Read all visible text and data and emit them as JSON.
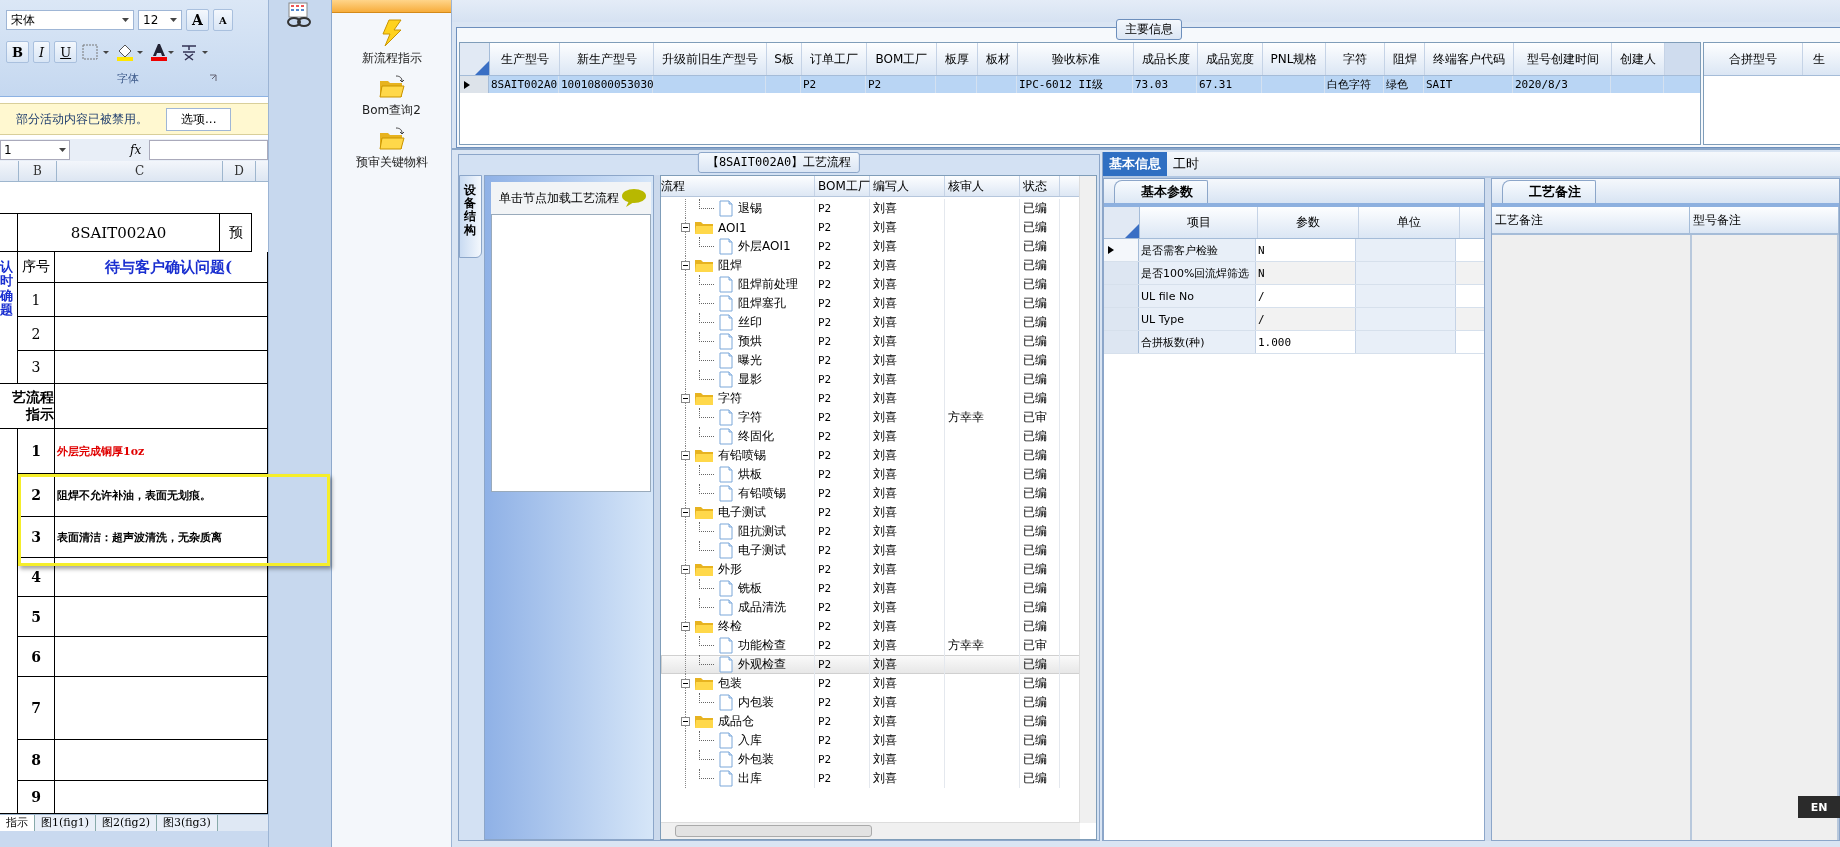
{
  "excel": {
    "font_name": "宋体",
    "font_size": "12",
    "grow_font": "A",
    "shrink_font": "A",
    "bold": "B",
    "italic": "I",
    "underline": "U",
    "group_label": "字体",
    "message": "部分活动内容已被禁用。",
    "options_button": "选项...",
    "name_box": "1",
    "fx": "fx",
    "columns": [
      "B",
      "C",
      "D"
    ],
    "title_cell": "8SAIT002A0",
    "title_right": "预",
    "seq_header": "序号",
    "question_header": "待与客户确认问题(",
    "side_label": "认时确题",
    "question_rows": [
      "1",
      "2",
      "3"
    ],
    "process_label": [
      "艺流程",
      "指示"
    ],
    "process_rows": [
      {
        "num": "1",
        "text": "外层完成铜厚1oz",
        "kind": "warning",
        "highlighted": false
      },
      {
        "num": "2",
        "text": "阻焊不允许补油，表面无划痕。",
        "kind": "normal",
        "highlighted": true
      },
      {
        "num": "3",
        "text": "表面清洁：超声波清洗，无杂质离",
        "kind": "normal",
        "highlighted": true
      },
      {
        "num": "4",
        "highlighted": false
      },
      {
        "num": "5",
        "highlighted": false
      },
      {
        "num": "6",
        "highlighted": false
      },
      {
        "num": "7",
        "highlighted": false
      },
      {
        "num": "8",
        "highlighted": false
      },
      {
        "num": "9",
        "highlighted": false
      }
    ],
    "sheet_tabs": [
      {
        "label": "指示",
        "selected": true
      },
      {
        "label": "图1(fig1)",
        "selected": false
      },
      {
        "label": "图2(fig2)",
        "selected": false
      },
      {
        "label": "图3(fig3)",
        "selected": false
      }
    ]
  },
  "nav": {
    "items": [
      {
        "label": "新流程指示",
        "kind": "lightning"
      },
      {
        "label": "Bom查询2",
        "kind": "folder"
      },
      {
        "label": "预审关键物料",
        "kind": "folder"
      }
    ]
  },
  "main_info": {
    "title": "主要信息",
    "columns": [
      "生产型号",
      "新生产型号",
      "升级前旧生产型号",
      "S板",
      "订单工厂",
      "BOM工厂",
      "板厚",
      "板材",
      "验收标准",
      "成品长度",
      "成品宽度",
      "PNL规格",
      "字符",
      "阻焊",
      "终端客户代码",
      "型号创建时间",
      "创建人"
    ],
    "rows": [
      {
        "selected": true,
        "cells": [
          "8SAIT002A0",
          "10010800053030",
          null,
          null,
          "P2",
          "P2",
          null,
          null,
          "IPC-6012 II级",
          "73.03",
          "67.31",
          null,
          "白色字符",
          "绿色",
          "SAIT",
          "2020/8/3",
          null
        ]
      }
    ],
    "merge_columns": [
      "合拼型号",
      "生"
    ]
  },
  "flow": {
    "title": "【8SAIT002A0】工艺流程",
    "side_tab": "设备结构",
    "hint": "单击节点加载工艺流程",
    "columns": [
      "流程",
      "BOM工厂",
      "编写人",
      "核审人",
      "状态"
    ],
    "continued": [
      {
        "label": "退锡",
        "bom": "P2",
        "writer": "刘喜",
        "status": "已编",
        "selected": false
      }
    ],
    "nodes": [
      {
        "label": "AOI1",
        "bom": "P2",
        "writer": "刘喜",
        "status": "已编",
        "expanded": true,
        "selected": false,
        "children": [
          {
            "label": "外层AOI1",
            "bom": "P2",
            "writer": "刘喜",
            "status": "已编",
            "selected": false
          }
        ]
      },
      {
        "label": "阻焊",
        "bom": "P2",
        "writer": "刘喜",
        "status": "已编",
        "expanded": true,
        "selected": false,
        "children": [
          {
            "label": "阻焊前处理",
            "bom": "P2",
            "writer": "刘喜",
            "status": "已编",
            "selected": false
          },
          {
            "label": "阻焊塞孔",
            "bom": "P2",
            "writer": "刘喜",
            "status": "已编",
            "selected": false
          },
          {
            "label": "丝印",
            "bom": "P2",
            "writer": "刘喜",
            "status": "已编",
            "selected": false
          },
          {
            "label": "预烘",
            "bom": "P2",
            "writer": "刘喜",
            "status": "已编",
            "selected": false
          },
          {
            "label": "曝光",
            "bom": "P2",
            "writer": "刘喜",
            "status": "已编",
            "selected": false
          },
          {
            "label": "显影",
            "bom": "P2",
            "writer": "刘喜",
            "status": "已编",
            "selected": false
          }
        ]
      },
      {
        "label": "字符",
        "bom": "P2",
        "writer": "刘喜",
        "status": "已编",
        "expanded": true,
        "selected": false,
        "children": [
          {
            "label": "字符",
            "bom": "P2",
            "writer": "刘喜",
            "reviewer": "方幸幸",
            "status": "已审",
            "selected": false
          },
          {
            "label": "终固化",
            "bom": "P2",
            "writer": "刘喜",
            "status": "已编",
            "selected": false
          }
        ]
      },
      {
        "label": "有铅喷锡",
        "bom": "P2",
        "writer": "刘喜",
        "status": "已编",
        "expanded": true,
        "selected": false,
        "children": [
          {
            "label": "烘板",
            "bom": "P2",
            "writer": "刘喜",
            "status": "已编",
            "selected": false
          },
          {
            "label": "有铅喷锡",
            "bom": "P2",
            "writer": "刘喜",
            "status": "已编",
            "selected": false
          }
        ]
      },
      {
        "label": "电子测试",
        "bom": "P2",
        "writer": "刘喜",
        "status": "已编",
        "expanded": true,
        "selected": false,
        "children": [
          {
            "label": "阻抗测试",
            "bom": "P2",
            "writer": "刘喜",
            "status": "已编",
            "selected": false
          },
          {
            "label": "电子测试",
            "bom": "P2",
            "writer": "刘喜",
            "status": "已编",
            "selected": false
          }
        ]
      },
      {
        "label": "外形",
        "bom": "P2",
        "writer": "刘喜",
        "status": "已编",
        "expanded": true,
        "selected": false,
        "children": [
          {
            "label": "铣板",
            "bom": "P2",
            "writer": "刘喜",
            "status": "已编",
            "selected": false
          },
          {
            "label": "成品清洗",
            "bom": "P2",
            "writer": "刘喜",
            "status": "已编",
            "selected": false
          }
        ]
      },
      {
        "label": "终检",
        "bom": "P2",
        "writer": "刘喜",
        "status": "已编",
        "expanded": true,
        "selected": false,
        "children": [
          {
            "label": "功能检查",
            "bom": "P2",
            "writer": "刘喜",
            "reviewer": "方幸幸",
            "status": "已审",
            "selected": false
          },
          {
            "label": "外观检查",
            "bom": "P2",
            "writer": "刘喜",
            "status": "已编",
            "selected": true
          }
        ]
      },
      {
        "label": "包装",
        "bom": "P2",
        "writer": "刘喜",
        "status": "已编",
        "expanded": true,
        "selected": false,
        "children": [
          {
            "label": "内包装",
            "bom": "P2",
            "writer": "刘喜",
            "status": "已编",
            "selected": false
          }
        ]
      },
      {
        "label": "成品仓",
        "bom": "P2",
        "writer": "刘喜",
        "status": "已编",
        "expanded": true,
        "selected": false,
        "children": [
          {
            "label": "入库",
            "bom": "P2",
            "writer": "刘喜",
            "status": "已编",
            "selected": false
          },
          {
            "label": "外包装",
            "bom": "P2",
            "writer": "刘喜",
            "status": "已编",
            "selected": false
          },
          {
            "label": "出库",
            "bom": "P2",
            "writer": "刘喜",
            "status": "已编",
            "selected": false
          }
        ]
      }
    ]
  },
  "info": {
    "tabs": [
      {
        "label": "基本信息",
        "selected": true
      },
      {
        "label": "工时",
        "selected": false
      }
    ],
    "params_tab": "基本参数",
    "params_columns": [
      "项目",
      "参数",
      "单位"
    ],
    "params": [
      {
        "item": "是否需客户检验",
        "value": "N",
        "selected": true
      },
      {
        "item": "是否100%回流焊筛选",
        "value": "N",
        "selected": false
      },
      {
        "item": "UL file No",
        "value": "/",
        "selected": false
      },
      {
        "item": "UL Type",
        "value": "/",
        "selected": false
      },
      {
        "item": "合拼板数(种)",
        "value": "1.000",
        "selected": false
      }
    ],
    "notes_tab": "工艺备注",
    "notes_columns": [
      "工艺备注",
      "型号备注"
    ]
  },
  "language": "EN"
}
